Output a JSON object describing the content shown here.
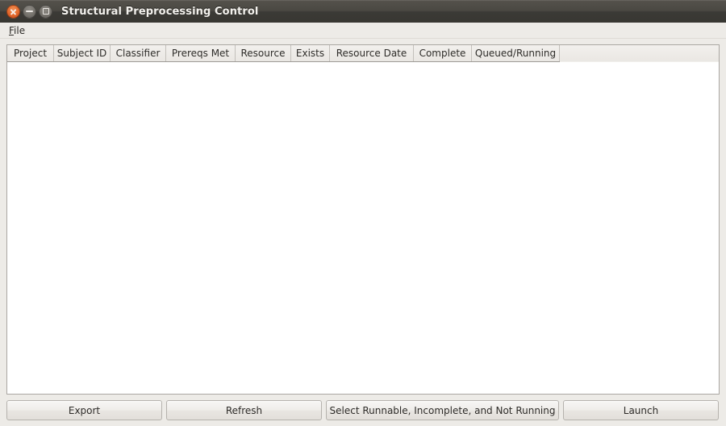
{
  "window": {
    "title": "Structural Preprocessing Control",
    "controls": [
      {
        "name": "close-button",
        "icon": "close-icon"
      },
      {
        "name": "minimize-button",
        "icon": "minimize-icon"
      },
      {
        "name": "maximize-button",
        "icon": "maximize-icon"
      }
    ]
  },
  "menubar": {
    "items": [
      {
        "label": "File",
        "mnemonic": "F",
        "rest": "ile"
      }
    ]
  },
  "table": {
    "columns": [
      {
        "label": "Project",
        "width": 58
      },
      {
        "label": "Subject ID",
        "width": 70
      },
      {
        "label": "Classifier",
        "width": 69
      },
      {
        "label": "Prereqs Met",
        "width": 86
      },
      {
        "label": "Resource",
        "width": 69
      },
      {
        "label": "Exists",
        "width": 48
      },
      {
        "label": "Resource Date",
        "width": 104
      },
      {
        "label": "Complete",
        "width": 72
      },
      {
        "label": "Queued/Running",
        "width": 109
      }
    ],
    "rows": [],
    "empty": true
  },
  "buttons": [
    {
      "label": "Export",
      "name": "export-button"
    },
    {
      "label": "Refresh",
      "name": "refresh-button"
    },
    {
      "label": "Select Runnable, Incomplete, and Not Running",
      "name": "select-runnable-button"
    },
    {
      "label": "Launch",
      "name": "launch-button"
    }
  ],
  "colors": {
    "titlebar_top": "#55524c",
    "titlebar_bottom": "#383732",
    "close_accent": "#e4692c",
    "chrome_bg": "#edebe7",
    "table_bg": "#ffffff",
    "border": "#aaa7a2"
  }
}
